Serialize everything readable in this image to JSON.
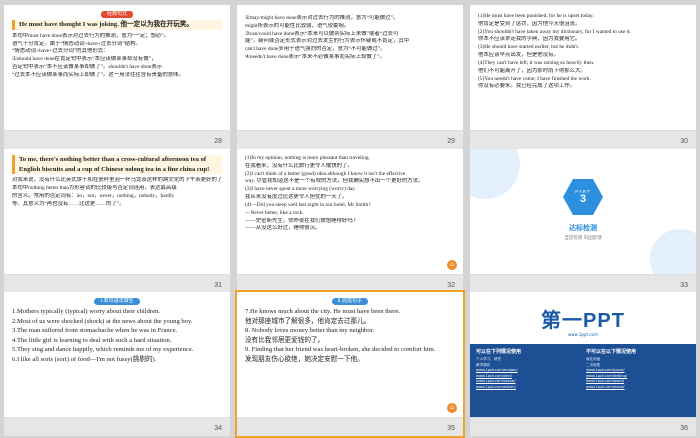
{
  "slides": [
    {
      "number": "28",
      "tag": "经典句式",
      "lines": [
        "He must have thought I was joking. 他一定以为我在开玩笑。",
        "本句中must have done表示对过去行为的推测，意为“一定；想必”。",
        "语气十分肯定。属于“情态动词+have+过去分词”结构。",
        "“情态动词+have+过去分词”的其他形式：",
        "①should have done在肯定句中表示“本应该做某事却没有做”，",
        "否定句中表示“本不应该做某事却做了”。shouldn't have done表示",
        "“过去本不应该做某事而实际上却做了”。这一用法往往含有责备的意味。"
      ]
    },
    {
      "number": "29",
      "lines": [
        "②may/might have done表示对过去行为的推测，意为“可能做过”。",
        "might所表示的可能性比较弱，语气较委婉。",
        "③can/could have done表示“本来可以做到实际上未做”或者“过去可",
        "能”，疑问或否定形式表示对过去发生的行为表示怀疑或不肯定，其中",
        "can't have done多用于语气强烈的否定，意为“不可能做过”。",
        "④needn't have done表示“本来不必做某事而实际上却做了”。"
      ]
    },
    {
      "number": "30",
      "lines": [
        "(1)He must have been punished, for he is upset today.",
        "他肯定是受到了惩罚，因为他今天很沮丧。",
        "(2)You shouldn't have taken away my dictionary, for I wanted to use it.",
        "你本不应该拿走我的字典，因为我要用它。",
        "(3)He should have started earlier, but he didn't.",
        "他本应该早点出发，但是他没有。",
        "(4)They can't have left; it was raining so heavily then.",
        "他们不可能离开了，因为那时雨下得那么大。",
        "(5)You needn't have come; I have finished the work.",
        "你没有必要来。我已经完成了这项工作。"
      ]
    },
    {
      "number": "31",
      "lines": [
        "To me, there's nothing better than a cross-cultural afternoon tea of",
        "English biscuits and a cup of Chinese oolong tea in a fine china cup!",
        "对我来说，没有什么比英式饼干和在瓷杯里泡一杯乌龙茶这样的跨文化的下午茶更好的了！",
        "本句中nothing better than为形容词的比较级与否定词连用，表达最高级",
        "的含义。常用的否定词有：no，not，never，nothing，nobody，hardly",
        "等。其意义为“再也没有……比这更……的了”。"
      ]
    },
    {
      "number": "32",
      "lines": [
        "(1)In my opinion, nothing is more pleasant than traveling.",
        "在我看来，没有什么比旅行更令人愉快的了。",
        "(2)I can't think of a better (good) idea although I know it isn't the effective",
        "way. 尽管我知道这不是一个有效的方法，但我确实想不出一个更好的方法。",
        "(3)I have never spent a more worrying (worry) day.",
        "我从来没有度过比这更令人担忧的一天了。",
        "(4)—Did you sleep well last night in our hotel, Mr Smith?",
        "—Never better, like a rock.",
        "——史密斯先生，你昨夜在我们旅馆睡得好吗？",
        "——从没这么好过，睡得很沉。"
      ]
    },
    {
      "number": "33",
      "part_label": "PART",
      "part_number": "3",
      "title": "达标检测",
      "subtitle": "当堂检测 巩固反馈"
    },
    {
      "number": "34",
      "tag": "Ⅰ.单句语法填空",
      "lines": [
        "1.Mothers typically (typical) worry about their children.",
        "2.Most of us were shocked (shock) at the news about the young boy.",
        "3.The man suffered from stomachache when he was in France.",
        "4.The little girl is learning to deal with such a hard situation.",
        "5.They sing and dance happily, which reminds me of my experience.",
        "6.I like all sorts (sort) of food—I'm not fussy(挑剔的)."
      ]
    },
    {
      "number": "35",
      "tag": "Ⅱ.完成句子",
      "lines": [
        "7.He knows much about the city. He must have been there.",
        "他对那座城市了解很多，他肯定去过那儿。",
        "8. Nobody loves money better than my neighbor.",
        "没有比我邻居更爱钱的了。",
        "9. Finding that her friend was heart-broken, she decided to comfort him.",
        "发现朋友伤心欲绝，她决定安慰一下他。"
      ]
    },
    {
      "number": "36",
      "logo": "第一PPT",
      "logo_sub": "www.1ppt.com",
      "left_heading": "可以在下列情况使用",
      "right_heading": "不可以在以下情况使用",
      "left_rows": [
        "个人学习、研究",
        "教学课件",
        "www.1ppt.com/moban/",
        "www.1ppt.com/jieri/",
        "www.1ppt.com/xiazai/",
        "www.1ppt.com/kejian/"
      ],
      "right_rows": [
        "商业用途",
        "二次转售",
        "www.1ppt.com/sucai/",
        "www.1ppt.com/beijing/",
        "www.1ppt.com/word/",
        "www.1ppt.com/excel/"
      ]
    }
  ]
}
